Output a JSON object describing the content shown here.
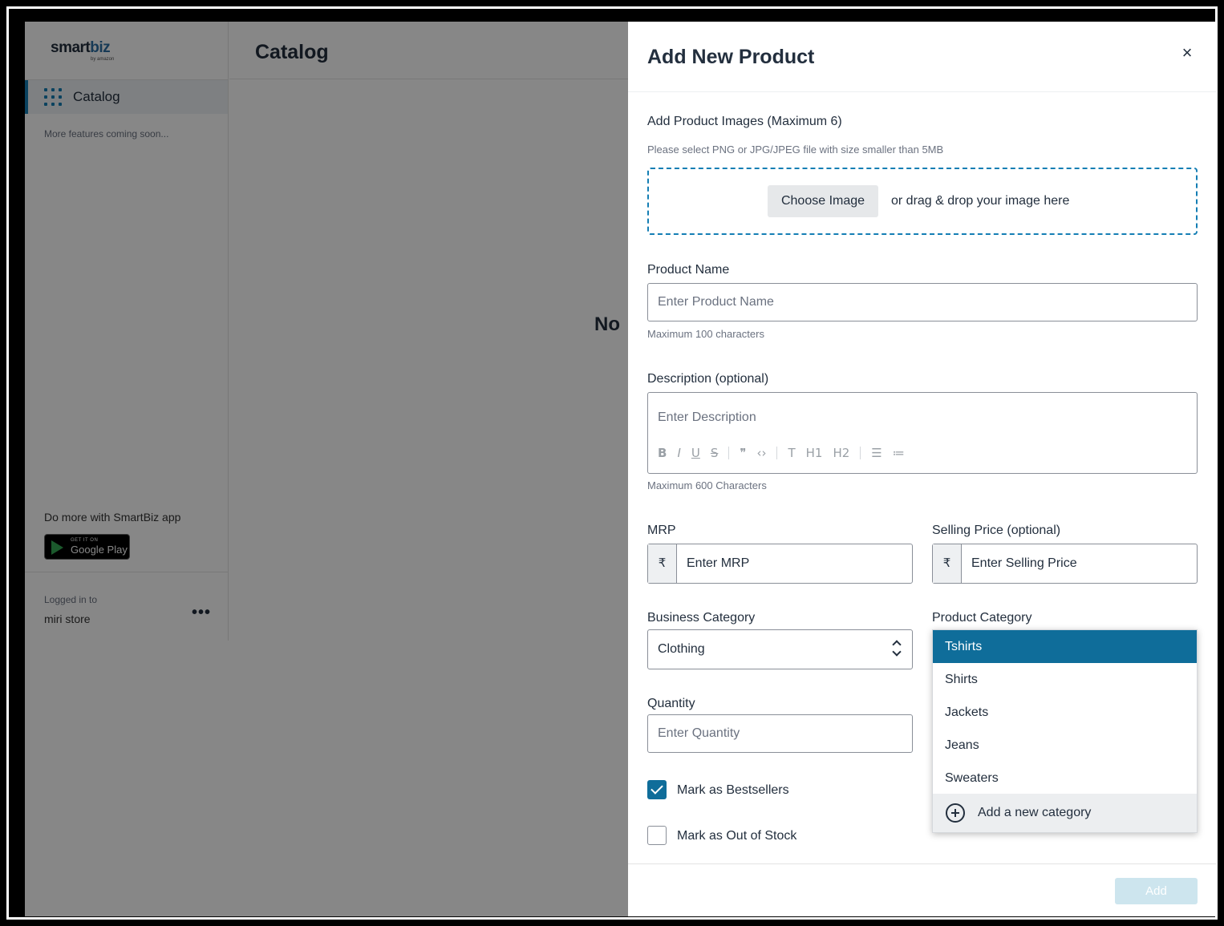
{
  "app": {
    "logo_main": "smart",
    "logo_accent": "biz",
    "logo_sub": "by amazon",
    "page_title": "Catalog",
    "empty_text": "No",
    "sidebar": {
      "items": [
        {
          "label": "Catalog",
          "icon": "grid-icon"
        }
      ],
      "coming_soon": "More features coming soon...",
      "promo": "Do more with SmartBiz app",
      "gplay_small": "GET IT ON",
      "gplay_big": "Google Play",
      "logged_in_label": "Logged in to",
      "store_name": "miri store",
      "more_icon": "more-icon",
      "more_glyph": "•••"
    }
  },
  "modal": {
    "title": "Add New Product",
    "close_glyph": "×",
    "images": {
      "label": "Add Product Images (Maximum 6)",
      "hint": "Please select PNG or JPG/JPEG file with size smaller than 5MB",
      "choose_button": "Choose Image",
      "drag_text": "or drag & drop your image here"
    },
    "product_name": {
      "label": "Product Name",
      "placeholder": "Enter Product Name",
      "hint": "Maximum 100 characters"
    },
    "description": {
      "label": "Description (optional)",
      "placeholder": "Enter Description",
      "hint": "Maximum 600 Characters",
      "toolbar": [
        "B",
        "I",
        "U",
        "S",
        "❞",
        "‹›",
        "T",
        "H1",
        "H2",
        "☰",
        "≔"
      ]
    },
    "mrp": {
      "label": "MRP",
      "prefix": "₹",
      "placeholder": "Enter MRP"
    },
    "selling_price": {
      "label": "Selling Price (optional)",
      "prefix": "₹",
      "placeholder": "Enter Selling Price"
    },
    "business_category": {
      "label": "Business Category",
      "value": "Clothing"
    },
    "product_category": {
      "label": "Product Category",
      "options": [
        "Tshirts",
        "Shirts",
        "Jackets",
        "Jeans",
        "Sweaters"
      ],
      "selected": "Tshirts",
      "add_new": "Add a new category"
    },
    "quantity": {
      "label": "Quantity",
      "placeholder": "Enter Quantity"
    },
    "bestsellers": {
      "label": "Mark as Bestsellers",
      "checked": true
    },
    "out_of_stock": {
      "label": "Mark as Out of Stock",
      "checked": false
    },
    "add_button": "Add"
  },
  "colors": {
    "accent": "#0f6d9a",
    "nav_accent": "#147eb4",
    "disabled_button": "#cde5ee"
  }
}
